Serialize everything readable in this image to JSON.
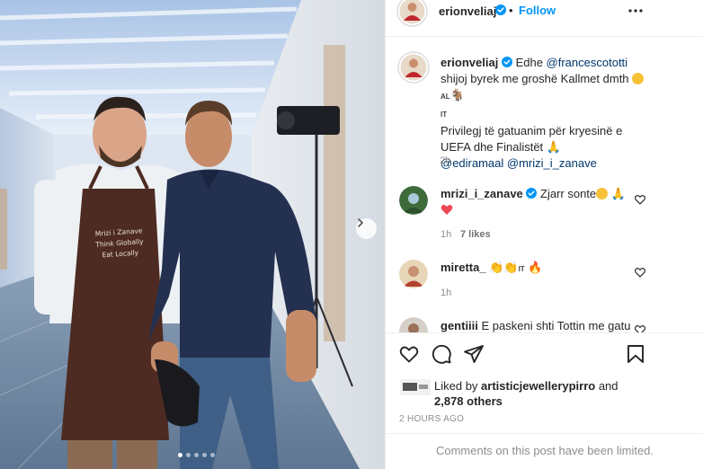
{
  "post": {
    "username": "erionveliaj",
    "follow_label": "Follow",
    "separator": "•",
    "apron_lines": [
      "Mrizi i Zanave",
      "Think Globally",
      "Eat Locally"
    ],
    "carousel": {
      "slides": 5,
      "active": 1
    }
  },
  "caption": {
    "username": "erionveliaj",
    "text_1": "Edhe ",
    "mention_1": "@francescototti",
    "text_2": " shijoj byrek me groshë Kallmet dmth ",
    "flag_1": "AL",
    "flag_2": "IT",
    "line_2": "Privilegj të gatuanim për kryesinë e UEFA dhe Finalistët ",
    "mention_2": "@ediramaal",
    "mention_3": "@mrizi_i_zanave",
    "time": "2h"
  },
  "comments": [
    {
      "username": "mrizi_i_zanave",
      "text": " Zjarr sonte",
      "time": "1h",
      "likes": "7 likes",
      "verified": true
    },
    {
      "username": "miretta_",
      "text": " ",
      "flag": "IT",
      "time": "1h",
      "verified": false
    },
    {
      "username": "gentiiii",
      "text": " E paskeni shti Tottin me gatu",
      "verified": false
    }
  ],
  "liked_by": {
    "prefix": "Liked by ",
    "user": "artisticjewellerypirro",
    "middle": " and",
    "others": "2,878 others"
  },
  "timestamp": "2 HOURS AGO",
  "comments_limited": "Comments on this post have been limited.",
  "colors": {
    "accent": "#0095f6",
    "verified": "#0095f6",
    "heart_red": "#ed4956",
    "muted": "#8e8e8e"
  },
  "icons": [
    "verified-badge-icon",
    "more-options-icon",
    "heart-icon",
    "comment-icon",
    "share-icon",
    "bookmark-icon",
    "chevron-right-icon"
  ]
}
